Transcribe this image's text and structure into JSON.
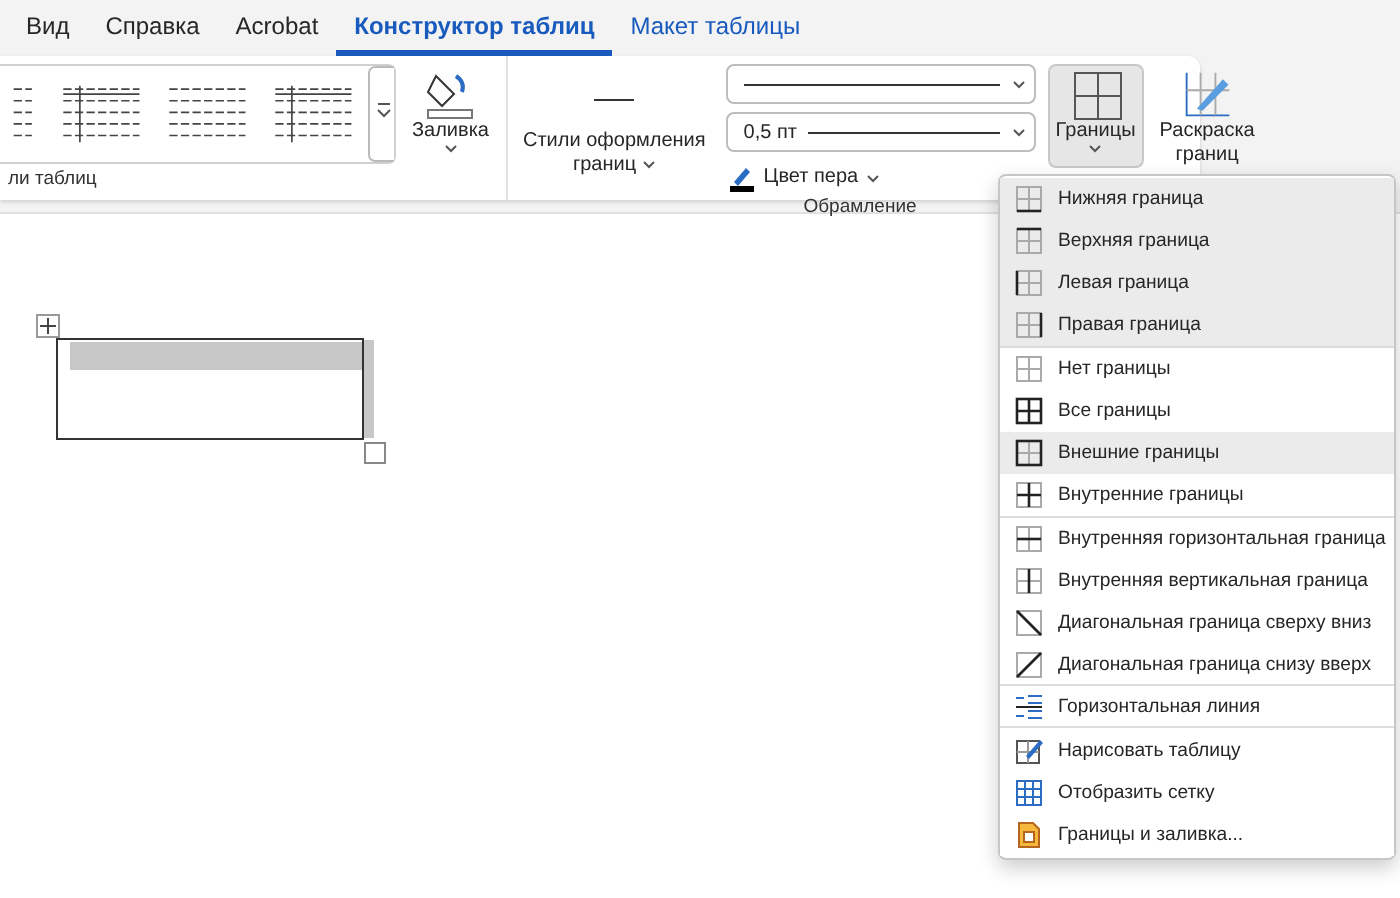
{
  "tabs": [
    {
      "label": "Вид",
      "selected": false,
      "contextual": false
    },
    {
      "label": "Справка",
      "selected": false,
      "contextual": false
    },
    {
      "label": "Acrobat",
      "selected": false,
      "contextual": false
    },
    {
      "label": "Конструктор таблиц",
      "selected": true,
      "contextual": true
    },
    {
      "label": "Макет таблицы",
      "selected": false,
      "contextual": true
    }
  ],
  "ribbon": {
    "styles_group": {
      "label": "ли таблиц",
      "fill_button": "Заливка"
    },
    "borders_group": {
      "label": "Обрамление",
      "border_styles": [
        "Стили оформления",
        "границ"
      ],
      "line_weight": "0,5 пт",
      "pen_color": "Цвет пера",
      "borders_button": {
        "label": "Границы",
        "pressed": true
      },
      "painter_button": [
        "Раскраска",
        "границ"
      ]
    }
  },
  "menu": {
    "items": [
      {
        "kind": "bottom",
        "label": "Нижняя граница",
        "highlighted": true
      },
      {
        "kind": "top",
        "label": "Верхняя граница",
        "highlighted": true
      },
      {
        "kind": "left",
        "label": "Левая граница",
        "highlighted": true
      },
      {
        "kind": "right",
        "label": "Правая граница",
        "highlighted": true,
        "separator_after": true
      },
      {
        "kind": "none",
        "label": "Нет границы",
        "highlighted": false
      },
      {
        "kind": "all",
        "label": "Все границы",
        "highlighted": false
      },
      {
        "kind": "outside",
        "label": "Внешние границы",
        "highlighted": true
      },
      {
        "kind": "inside",
        "label": "Внутренние границы",
        "highlighted": false,
        "separator_after": true
      },
      {
        "kind": "inside_h",
        "label": "Внутренняя горизонтальная граница",
        "highlighted": false
      },
      {
        "kind": "inside_v",
        "label": "Внутренняя вертикальная граница",
        "highlighted": false
      },
      {
        "kind": "diag_down",
        "label": "Диагональная граница сверху вниз",
        "highlighted": false
      },
      {
        "kind": "diag_up",
        "label": "Диагональная граница снизу вверх",
        "highlighted": false,
        "separator_after": true
      },
      {
        "kind": "hline",
        "label": "Горизонтальная линия",
        "highlighted": false,
        "separator_after": true
      },
      {
        "kind": "draw",
        "label": "Нарисовать таблицу",
        "highlighted": false
      },
      {
        "kind": "grid",
        "label": "Отобразить сетку",
        "highlighted": false
      },
      {
        "kind": "dialog",
        "label": "Границы и заливка...",
        "highlighted": false
      }
    ]
  }
}
